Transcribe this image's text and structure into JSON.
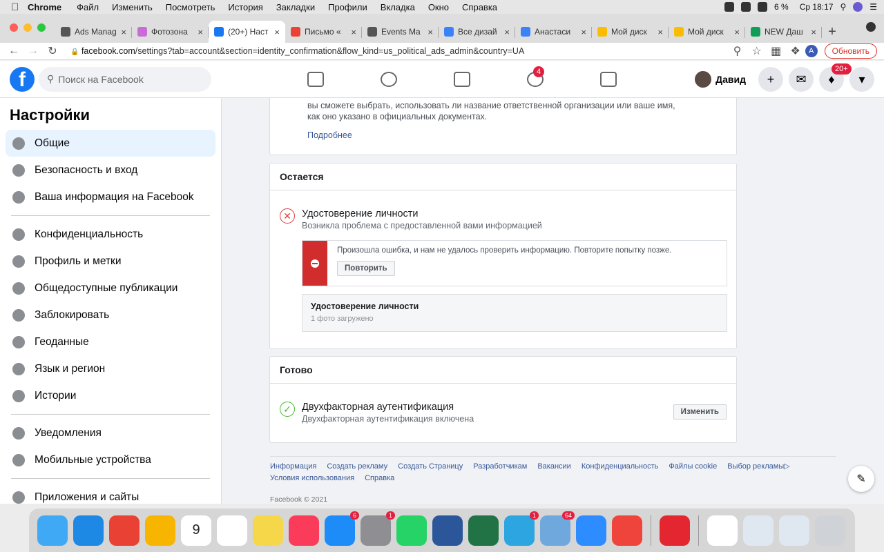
{
  "menubar": {
    "app": "Chrome",
    "items": [
      "Файл",
      "Изменить",
      "Посмотреть",
      "История",
      "Закладки",
      "Профили",
      "Вкладка",
      "Окно",
      "Справка"
    ],
    "battery": "6 %",
    "clock": "Ср 18:17"
  },
  "tabs": [
    {
      "title": "Ads Manag",
      "color": "#555"
    },
    {
      "title": "Фотозона",
      "color": "#c86dd7"
    },
    {
      "title": "(20+) Наст",
      "color": "#1877f2",
      "active": true
    },
    {
      "title": "Письмо «",
      "color": "#ea4335"
    },
    {
      "title": "Events Ma",
      "color": "#555"
    },
    {
      "title": "Все дизай",
      "color": "#3b82f6"
    },
    {
      "title": "Анастаси",
      "color": "#3b82f6"
    },
    {
      "title": "Мой диск",
      "color": "#fbbc04"
    },
    {
      "title": "Мой диск",
      "color": "#fbbc04"
    },
    {
      "title": "NEW Даш",
      "color": "#0f9d58"
    }
  ],
  "address": {
    "domain": "facebook.com",
    "path": "/settings?tab=account&section=identity_confirmation&flow_kind=us_political_ads_admin&country=UA",
    "update": "Обновить",
    "profile_letter": "A"
  },
  "fb": {
    "search_placeholder": "Поиск на Facebook",
    "groups_badge": "4",
    "user": "Давид",
    "notif_badge": "20+"
  },
  "sidebar": {
    "title": "Настройки",
    "groups": [
      [
        {
          "label": "Общие",
          "selected": true
        },
        {
          "label": "Безопасность и вход"
        },
        {
          "label": "Ваша информация на Facebook"
        }
      ],
      [
        {
          "label": "Конфиденциальность"
        },
        {
          "label": "Профиль и метки"
        },
        {
          "label": "Общедоступные публикации"
        },
        {
          "label": "Заблокировать"
        },
        {
          "label": "Геоданные"
        },
        {
          "label": "Язык и регион"
        },
        {
          "label": "Истории"
        }
      ],
      [
        {
          "label": "Уведомления"
        },
        {
          "label": "Мобильные устройства"
        }
      ],
      [
        {
          "label": "Приложения и сайты"
        }
      ]
    ]
  },
  "main": {
    "intro_line1": "вы сможете выбрать, использовать ли название ответственной организации или ваше имя,",
    "intro_line2": "как оно указано в официальных документах.",
    "more_link": "Подробнее",
    "remaining": {
      "header": "Остается",
      "title": "Удостоверение личности",
      "subtitle": "Возникла проблема с предоставленной вами информацией",
      "error_text": "Произошла ошибка, и нам не удалось проверить информацию. Повторите попытку позже.",
      "retry": "Повторить",
      "doc_title": "Удостоверение личности",
      "doc_sub": "1 фото загружено"
    },
    "done": {
      "header": "Готово",
      "title": "Двухфакторная аутентификация",
      "subtitle": "Двухфакторная аутентификация включена",
      "change": "Изменить"
    }
  },
  "footer": {
    "links": [
      "Информация",
      "Создать рекламу",
      "Создать Страницу",
      "Разработчикам",
      "Вакансии",
      "Конфиденциальность",
      "Файлы cookie",
      "Выбор рекламы▷",
      "Условия использования",
      "Справка"
    ],
    "copyright": "Facebook © 2021"
  },
  "dock": {
    "apps": [
      {
        "name": "finder",
        "color": "#3fa9f5"
      },
      {
        "name": "safari",
        "color": "#1e88e5"
      },
      {
        "name": "chrome",
        "color": "#e94235"
      },
      {
        "name": "photos",
        "color": "#f7b500"
      },
      {
        "name": "calendar",
        "color": "#ffffff",
        "badge_text": "9"
      },
      {
        "name": "reminders",
        "color": "#ffffff"
      },
      {
        "name": "notes",
        "color": "#f6d74a"
      },
      {
        "name": "music",
        "color": "#fa3c5a"
      },
      {
        "name": "appstore",
        "color": "#1d8cf8",
        "badge": "6"
      },
      {
        "name": "settings",
        "color": "#8e8e93",
        "badge": "1"
      },
      {
        "name": "whatsapp",
        "color": "#25d366"
      },
      {
        "name": "word",
        "color": "#2b579a"
      },
      {
        "name": "excel",
        "color": "#217346"
      },
      {
        "name": "telegram",
        "color": "#2ca5e0",
        "badge": "1"
      },
      {
        "name": "mail",
        "color": "#6fa8dc",
        "badge": "64"
      },
      {
        "name": "zoom",
        "color": "#2d8cff"
      },
      {
        "name": "anydesk",
        "color": "#ef443b"
      },
      {
        "name": "opera",
        "color": "#e3262f"
      },
      {
        "name": "file",
        "color": "#ffffff"
      },
      {
        "name": "screenshot1",
        "color": "#dfe7f0"
      },
      {
        "name": "screenshot2",
        "color": "#dfe7f0"
      },
      {
        "name": "trash",
        "color": "#cfd3d7"
      }
    ]
  }
}
